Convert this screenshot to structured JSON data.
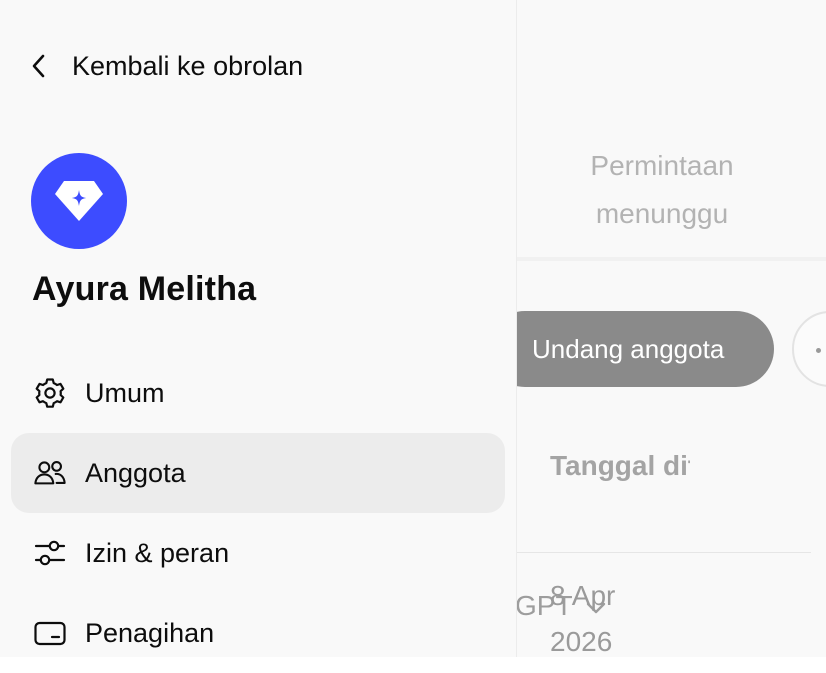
{
  "sidebar": {
    "back_label": "Kembali ke obrolan",
    "workspace_name": "Ayura Melitha",
    "avatar_color": "#3d4cff",
    "items": [
      {
        "label": "Umum",
        "icon": "gear-icon"
      },
      {
        "label": "Anggota",
        "icon": "people-icon",
        "active": true
      },
      {
        "label": "Izin & peran",
        "icon": "sliders-icon"
      },
      {
        "label": "Penagihan",
        "icon": "credit-card-icon"
      }
    ]
  },
  "main": {
    "tab_pending": "Permintaan menunggu",
    "invite_button": "Undang anggota",
    "table": {
      "column_date_header": "Tanggal ditambah",
      "rows": [
        {
          "date": "8 Apr 2026"
        }
      ]
    },
    "model_selector_text": "GPT"
  }
}
